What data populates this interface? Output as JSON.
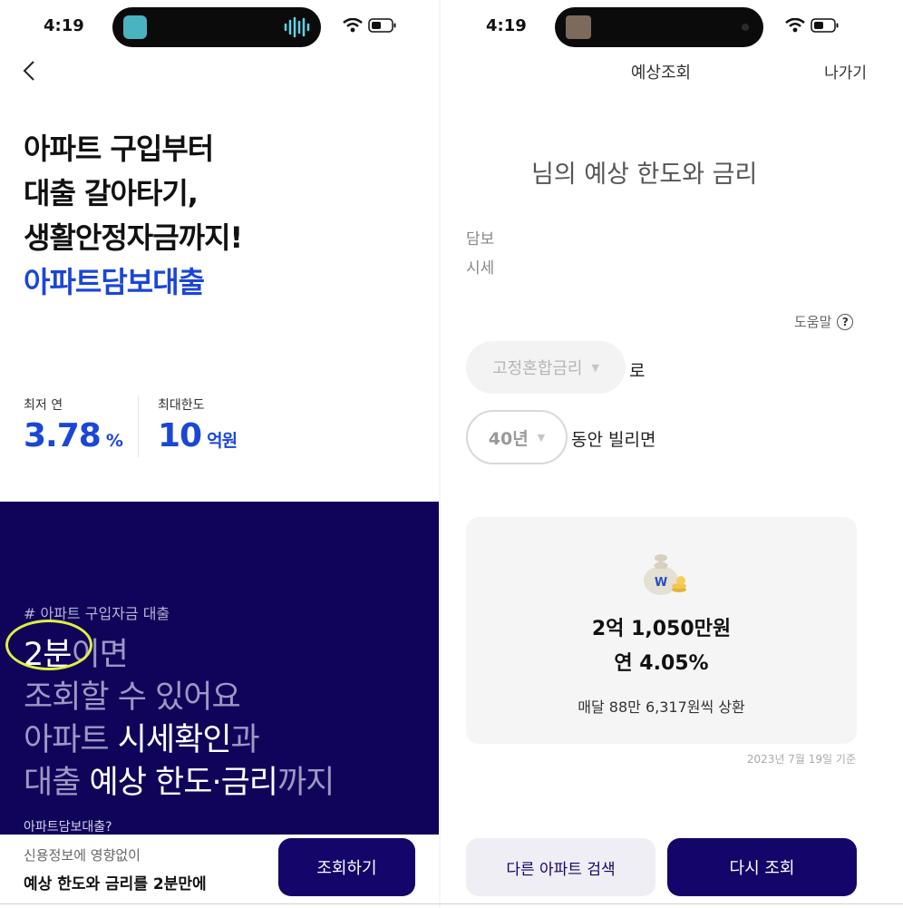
{
  "left": {
    "status": {
      "time": "4:19"
    },
    "hero": {
      "line1": "아파트 구입부터",
      "line2": "대출 갈아타기,",
      "line3": "생활안정자금까지!",
      "line4": "아파트담보대출"
    },
    "stats": {
      "min_rate_label": "최저 연",
      "min_rate_value": "3.78",
      "min_rate_unit": "%",
      "max_limit_label": "최대한도",
      "max_limit_value": "10",
      "max_limit_unit": "억원"
    },
    "promo": {
      "tag": "# 아파트 구입자금 대출",
      "l1_hl": "2분",
      "l1_rest": "이면",
      "l2": "조회할 수 있어요",
      "l3_dim": "아파트 ",
      "l3_hl": "시세확인",
      "l3_dim2": "과",
      "l4_dim": "대출 ",
      "l4_hl": "예상 한도·금리",
      "l4_dim2": "까지",
      "cut": "아파트담보대출?"
    },
    "bottom": {
      "sub": "신용정보에 영향없이",
      "main": "예상 한도와 금리를 2분만에",
      "button": "조회하기"
    }
  },
  "right": {
    "status": {
      "time": "4:19"
    },
    "header": {
      "title": "예상조회",
      "exit": "나가기"
    },
    "heading": "님의 예상 한도와 금리",
    "collateral_label": "담보",
    "price_label": "시세",
    "help": "도움말",
    "rate_type": "고정혼합금리",
    "rate_suffix": "로",
    "term": "40년",
    "term_suffix": "동안 빌리면",
    "result": {
      "amount": "2억 1,050만원",
      "rate": "연 4.05%",
      "monthly": "매달 88만 6,317원씩 상환"
    },
    "as_of": "2023년 7월 19일 기준",
    "buttons": {
      "other": "다른 아파트 검색",
      "again": "다시 조회"
    }
  },
  "colors": {
    "brand_blue": "#1b46d6",
    "navy": "#14056a",
    "promo_bg": "#10045a",
    "highlight_circle": "#e0ef3e"
  },
  "icons": [
    "back-arrow-icon",
    "wifi-icon",
    "battery-icon",
    "help-question-icon",
    "dropdown-caret-icon",
    "money-bag-icon"
  ]
}
